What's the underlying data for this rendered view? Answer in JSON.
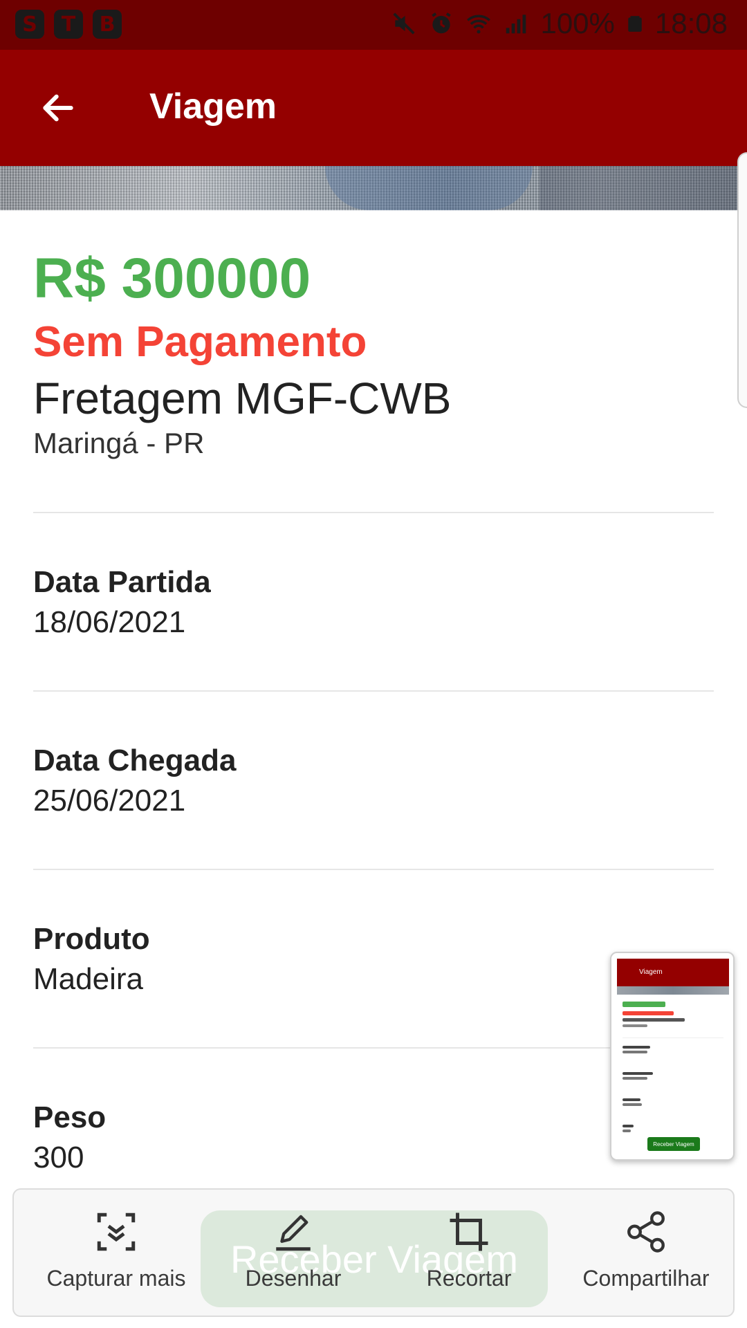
{
  "status_bar": {
    "apps": [
      "S",
      "T",
      "B"
    ],
    "battery": "100%",
    "time": "18:08"
  },
  "header": {
    "title": "Viagem"
  },
  "trip": {
    "price": "R$ 300000",
    "payment_status": "Sem Pagamento",
    "name": "Fretagem MGF-CWB",
    "city": "Maringá - PR"
  },
  "fields": [
    {
      "label": "Data Partida",
      "value": "18/06/2021"
    },
    {
      "label": "Data Chegada",
      "value": "25/06/2021"
    },
    {
      "label": "Produto",
      "value": "Madeira"
    },
    {
      "label": "Peso",
      "value": "300"
    }
  ],
  "receive_button": {
    "label": "Receber Viagem"
  },
  "screenshot_toolbar": {
    "items": [
      {
        "label": "Capturar mais",
        "icon": "scroll-capture-icon"
      },
      {
        "label": "Desenhar",
        "icon": "pen-icon"
      },
      {
        "label": "Recortar",
        "icon": "crop-icon"
      },
      {
        "label": "Compartilhar",
        "icon": "share-icon"
      }
    ]
  },
  "colors": {
    "status_bar": "#6e0000",
    "app_bar": "#940000",
    "price": "#4caf50",
    "payment_status": "#f44336",
    "receive_button": "#1b7a1b"
  }
}
